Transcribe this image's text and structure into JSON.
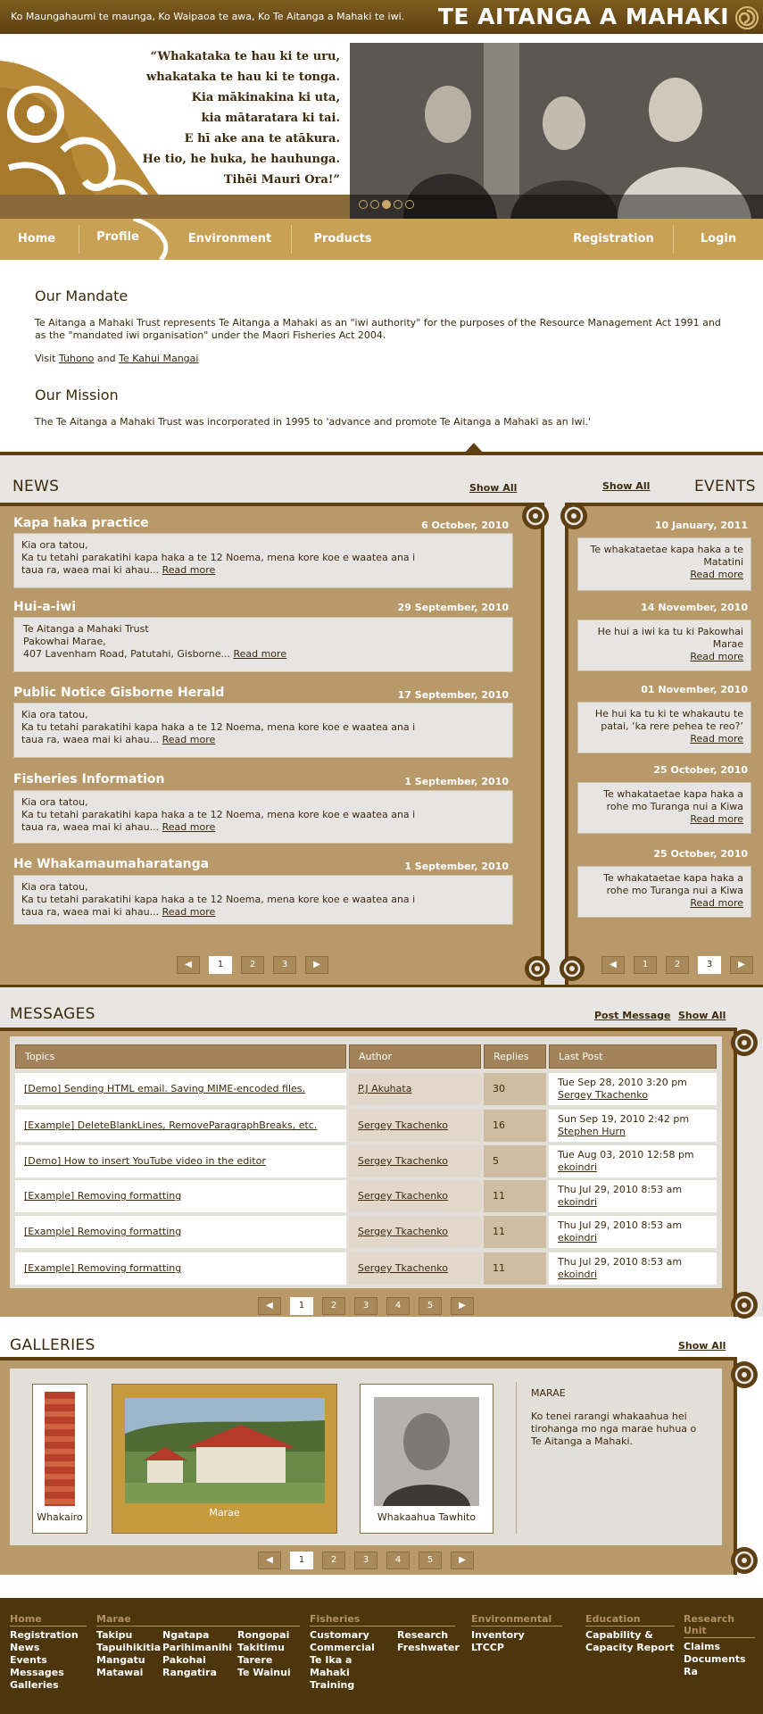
{
  "topbar": {
    "tagline": "Ko Maungahaumi te maunga, Ko Waipaoa te awa, Ko Te Aitanga a Mahaki te iwi.",
    "brand": "TE AITANGA A MAHAKI"
  },
  "hero": {
    "proverb": [
      "“Whakataka te hau ki te uru,",
      "whakataka te hau ki te tonga.",
      "Kia mākinakina ki uta,",
      "kia mātaratara ki tai.",
      "E hī ake ana te atākura.",
      "He tio, he huka, he hauhunga.",
      "Tihēi Mauri Ora!”"
    ]
  },
  "nav": {
    "home": "Home",
    "profile": "Profile",
    "environment": "Environment",
    "products": "Products",
    "registration": "Registration",
    "login": "Login"
  },
  "mandate": {
    "title": "Our Mandate",
    "body": "Te Aitanga a Mahaki Trust represents Te Aitanga a Mahaki as an \"iwi authority\" for the purposes of the Resource Management Act 1991 and as the \"mandated iwi organisation\" under the Maori Fisheries Act 2004.",
    "visit_prefix": "Visit",
    "link1": "Tuhono",
    "and": "and",
    "link2": "Te Kahui Mangai",
    "mission_title": "Our Mission",
    "mission_body": "The Te Aitanga a Mahaki Trust was incorporated in 1995 to 'advance and promote Te Aitanga a Mahaki as an Iwi.'"
  },
  "news": {
    "title": "NEWS",
    "show_all": "Show All",
    "read_more": "Read more",
    "items": [
      {
        "title": "Kapa haka practice",
        "date": "6 October, 2010",
        "lines": [
          "Kia ora tatou,",
          "Ka tu tetahi parakatihi kapa haka a te 12 Noema, mena kore koe e waatea ana i",
          "taua ra, waea mai ki ahau..."
        ]
      },
      {
        "title": "Hui-a-iwi",
        "date": "29 September, 2010",
        "lines": [
          "Te Aitanga a Mahaki Trust",
          "Pakowhai Marae,",
          "407 Lavenham Road, Patutahi, Gisborne..."
        ]
      },
      {
        "title": "Public Notice Gisborne Herald",
        "date": "17 September, 2010",
        "lines": [
          "Kia ora tatou,",
          "Ka tu tetahi parakatihi kapa haka a te 12 Noema, mena kore koe e waatea ana i",
          "taua ra, waea mai ki ahau..."
        ]
      },
      {
        "title": "Fisheries Information",
        "date": "1 September, 2010",
        "lines": [
          "Kia ora tatou,",
          "Ka tu tetahi parakatihi kapa haka a te 12 Noema, mena kore koe e waatea ana i",
          "taua ra, waea mai ki ahau..."
        ]
      },
      {
        "title": "He Whakamaumaharatanga",
        "date": "1 September, 2010",
        "lines": [
          "Kia ora tatou,",
          "Ka tu tetahi parakatihi kapa haka a te 12 Noema, mena kore koe e waatea ana i",
          "taua ra, waea mai ki ahau..."
        ]
      }
    ],
    "pages": [
      "1",
      "2",
      "3"
    ],
    "active_page": "1"
  },
  "events": {
    "title": "EVENTS",
    "show_all": "Show All",
    "read_more": "Read more",
    "items": [
      {
        "date": "10 January, 2011",
        "lines": [
          "Te whakataetae kapa haka a te",
          "Matatini"
        ]
      },
      {
        "date": "14 November, 2010",
        "lines": [
          "He hui a iwi ka tu ki Pakowhai",
          "Marae"
        ]
      },
      {
        "date": "01 November, 2010",
        "lines": [
          "He hui ka tu ki te whakautu te",
          "patai, ‘ka rere pehea te reo?’"
        ]
      },
      {
        "date": "25 October, 2010",
        "lines": [
          "Te whakataetae kapa haka a",
          "rohe mo Turanga nui a Kiwa"
        ]
      },
      {
        "date": "25 October, 2010",
        "lines": [
          "Te whakataetae kapa haka a",
          "rohe mo Turanga nui a Kiwa"
        ]
      }
    ],
    "pages": [
      "1",
      "2",
      "3"
    ],
    "active_page": "3"
  },
  "messages": {
    "title": "MESSAGES",
    "post": "Post Message",
    "show_all": "Show All",
    "headers": [
      "Topics",
      "Author",
      "Replies",
      "Last Post"
    ],
    "rows": [
      {
        "topic": "[Demo] Sending HTML email. Saving MIME-encoded files.",
        "author": "P.J Akuhata",
        "replies": "30",
        "last_date": "Tue Sep 28, 2010 3:20 pm",
        "last_by": "Sergey Tkachenko"
      },
      {
        "topic": "[Example] DeleteBlankLines, RemoveParagraphBreaks, etc.",
        "author": "Sergey Tkachenko",
        "replies": "16",
        "last_date": "Sun Sep 19, 2010 2:42 pm",
        "last_by": "Stephen Hurn"
      },
      {
        "topic": "[Demo] How to insert YouTube video in the editor",
        "author": "Sergey Tkachenko",
        "replies": "5",
        "last_date": "Tue Aug 03, 2010 12:58 pm",
        "last_by": "ekoindri"
      },
      {
        "topic": "[Example] Removing formatting",
        "author": "Sergey Tkachenko",
        "replies": "11",
        "last_date": "Thu Jul 29, 2010 8:53 am",
        "last_by": "ekoindri"
      },
      {
        "topic": "[Example] Removing formatting",
        "author": "Sergey Tkachenko",
        "replies": "11",
        "last_date": "Thu Jul 29, 2010 8:53 am",
        "last_by": "ekoindri"
      },
      {
        "topic": "[Example] Removing formatting",
        "author": "Sergey Tkachenko",
        "replies": "11",
        "last_date": "Thu Jul 29, 2010 8:53 am",
        "last_by": "ekoindri"
      }
    ],
    "pages": [
      "1",
      "2",
      "3",
      "4",
      "5"
    ],
    "active_page": "1"
  },
  "galleries": {
    "title": "GALLERIES",
    "show_all": "Show All",
    "cards": [
      {
        "label": "Whakairo"
      },
      {
        "label": "Marae"
      },
      {
        "label": "Whakaahua Tawhito"
      }
    ],
    "desc_title": "MARAE",
    "desc_body": "Ko tenei rarangi whakaahua hei tirohanga mo nga marae huhua o Te Aitanga a Mahaki.",
    "pages": [
      "1",
      "2",
      "3",
      "4",
      "5"
    ],
    "active_page": "1"
  },
  "footer": {
    "cols": [
      {
        "head": "Home",
        "items": [
          "Registration",
          "News",
          "Events",
          "Messages",
          "Galleries"
        ]
      },
      {
        "head": "Marae",
        "items": []
      },
      {
        "head": "Fisheries",
        "items": []
      },
      {
        "head": "Environmental",
        "items": [
          "Inventory",
          "LTCCP"
        ]
      },
      {
        "head": "Education",
        "items": [
          "Capability &",
          "Capacity Report"
        ]
      },
      {
        "head": "Research Unit",
        "items": [
          "Claims",
          "Documents",
          "Ra"
        ]
      }
    ],
    "marae_cols": [
      [
        "Takipu",
        "Tapuihikitia",
        "Mangatu",
        "Matawai"
      ],
      [
        "Ngatapa",
        "Parihimanihi",
        "Pakohai",
        "Rangatira"
      ],
      [
        "Rongopai",
        "Takitimu",
        "Tarere",
        "Te Wainui"
      ]
    ],
    "fisheries_cols": [
      [
        "Customary",
        "Commercial",
        "Te Ika a Mahaki",
        "Training"
      ],
      [
        "Research",
        "Freshwater"
      ]
    ]
  },
  "colors": {
    "brown_dark": "#5e3f12",
    "gold": "#c9a154",
    "tan": "#b8996a",
    "footer": "#4d350c"
  }
}
